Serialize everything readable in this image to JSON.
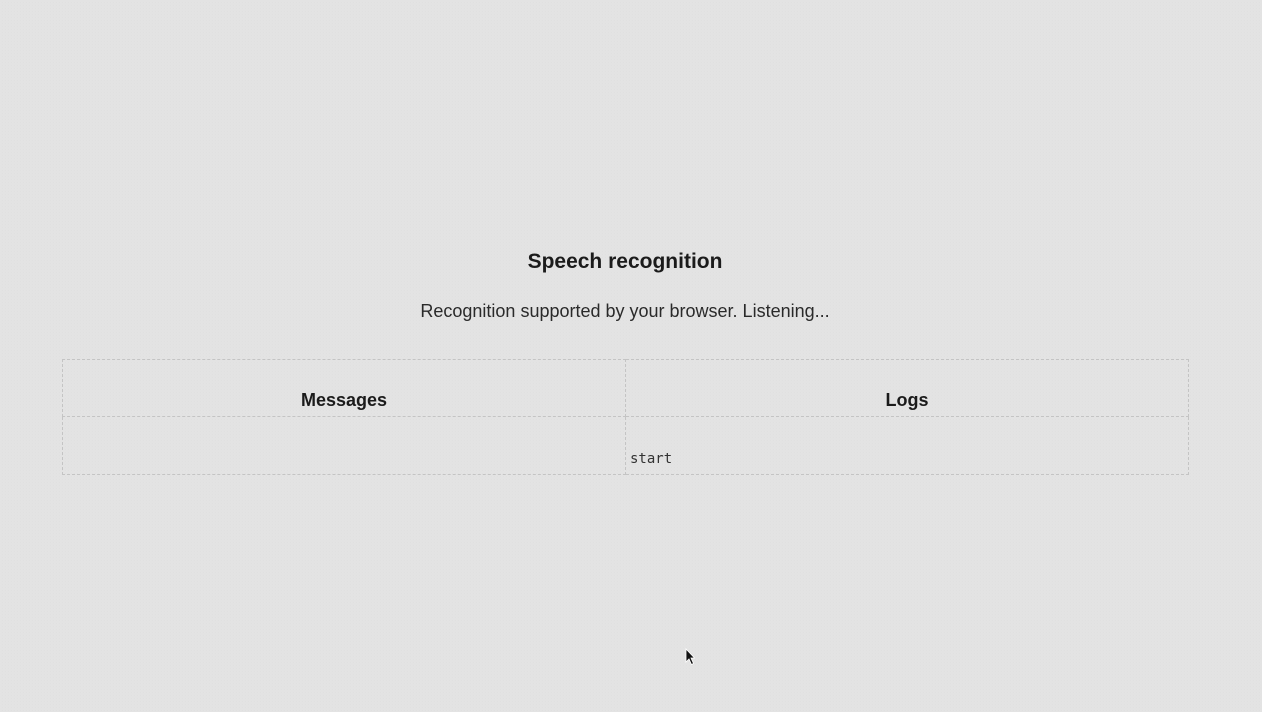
{
  "page": {
    "title": "Speech recognition",
    "status": "Recognition supported by your browser. Listening..."
  },
  "table": {
    "columns": [
      {
        "header": "Messages",
        "entries": []
      },
      {
        "header": "Logs",
        "entries": [
          "start"
        ]
      }
    ]
  },
  "cursor": {
    "icon": "mouse-pointer-icon"
  }
}
